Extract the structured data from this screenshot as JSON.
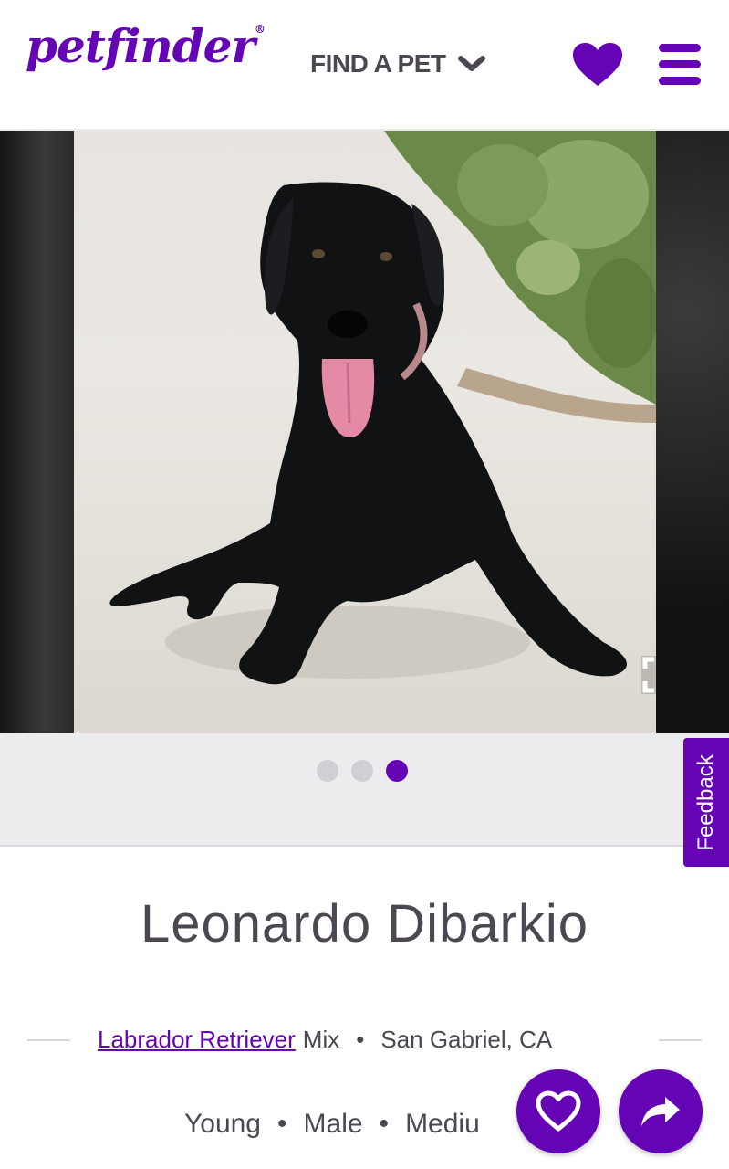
{
  "header": {
    "logo_text": "petfinder",
    "logo_mark": "®",
    "find_pet_label": "FIND A PET",
    "icons": {
      "dropdown": "chevron-down-icon",
      "favorites": "heart-icon",
      "menu": "hamburger-menu-icon"
    }
  },
  "carousel": {
    "photo_description_icon": "dog-photo",
    "expand_icon": "fullscreen-icon",
    "total_slides": 3,
    "active_slide": 3
  },
  "feedback": {
    "label": "Feedback"
  },
  "pet": {
    "name": "Leonardo Dibarkio",
    "breed_link": "Labrador Retriever",
    "breed_suffix": "Mix",
    "location": "San Gabriel, CA",
    "age": "Young",
    "sex": "Male",
    "size": "Mediu"
  },
  "actions": {
    "favorite_icon": "heart-outline-icon",
    "share_icon": "share-arrow-icon"
  },
  "colors": {
    "brand": "#6504b5",
    "text": "#4d4751",
    "dots_bg": "#ececef"
  }
}
